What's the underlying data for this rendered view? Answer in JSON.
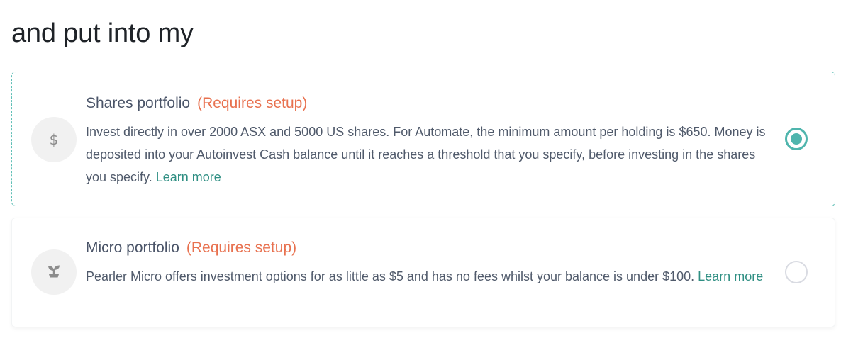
{
  "heading": "and put into my",
  "options": [
    {
      "title": "Shares portfolio",
      "tag": "(Requires setup)",
      "description": "Invest directly in over 2000 ASX and 5000 US shares. For Automate, the minimum amount per holding is $650. Money is deposited into your Autoinvest Cash balance until it reaches a threshold that you specify, before investing in the shares you specify.",
      "link": "Learn more",
      "icon": "dollar-icon",
      "icon_glyph": "$",
      "selected": true
    },
    {
      "title": "Micro portfolio",
      "tag": "(Requires setup)",
      "description": "Pearler Micro offers investment options for as little as $5 and has no fees whilst your balance is under $100.",
      "link": "Learn more",
      "icon": "sprout-icon",
      "selected": false
    }
  ],
  "colors": {
    "accent": "#4fb5ad",
    "tag": "#e8714f",
    "link": "#2f8f83",
    "text": "#505a6b"
  }
}
